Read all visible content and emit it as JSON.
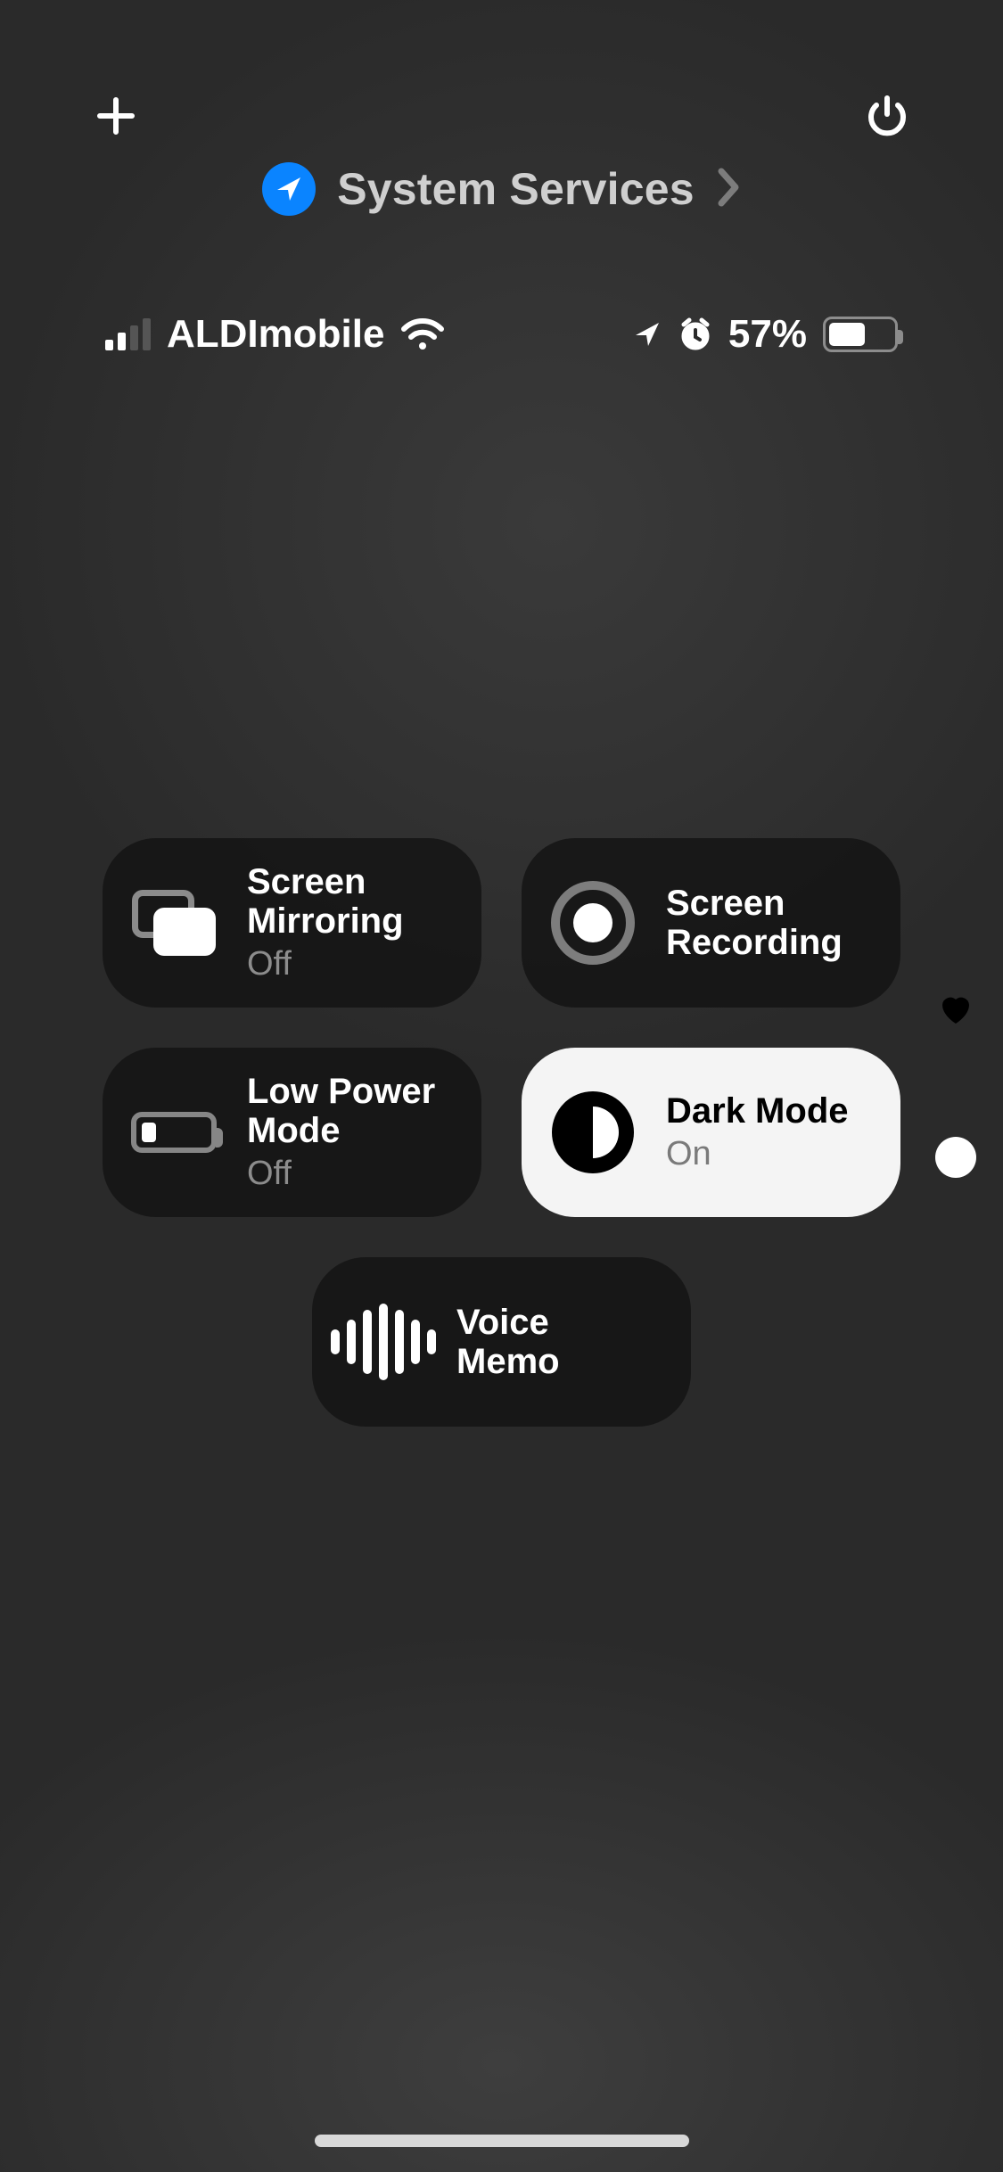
{
  "header": {
    "breadcrumb_label": "System Services"
  },
  "status_bar": {
    "carrier": "ALDImobile",
    "signal_bars_active": 2,
    "battery_percent_label": "57%",
    "battery_percent": 57
  },
  "tiles": {
    "screen_mirroring": {
      "title": "Screen Mirroring",
      "subtitle": "Off"
    },
    "screen_recording": {
      "title": "Screen Recording"
    },
    "low_power_mode": {
      "title": "Low Power Mode",
      "subtitle": "Off"
    },
    "dark_mode": {
      "title": "Dark Mode",
      "subtitle": "On"
    },
    "voice_memo": {
      "title": "Voice Memo"
    }
  }
}
